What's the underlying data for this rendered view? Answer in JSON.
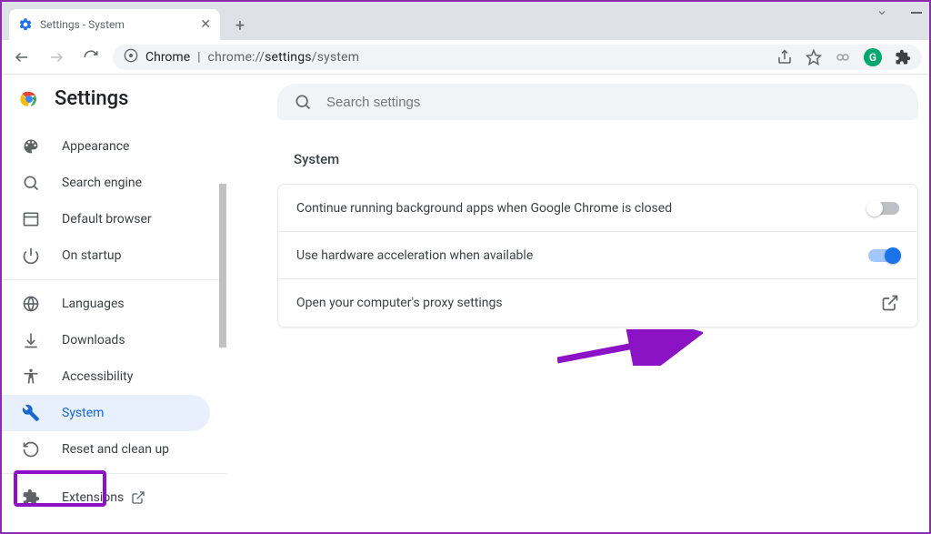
{
  "window": {
    "tab_title": "Settings - System",
    "close_glyph": "✕",
    "new_tab_glyph": "+"
  },
  "toolbar": {
    "url_prefix": "Chrome",
    "url_sep": "|",
    "url_proto": "chrome://",
    "url_path_bold": "settings",
    "url_path_tail": "/system"
  },
  "sidebar": {
    "title": "Settings",
    "items": [
      {
        "icon": "palette",
        "label": "Appearance"
      },
      {
        "icon": "search",
        "label": "Search engine"
      },
      {
        "icon": "browser",
        "label": "Default browser"
      },
      {
        "icon": "power",
        "label": "On startup"
      }
    ],
    "items2": [
      {
        "icon": "globe",
        "label": "Languages"
      },
      {
        "icon": "download",
        "label": "Downloads"
      },
      {
        "icon": "accessibility",
        "label": "Accessibility"
      },
      {
        "icon": "wrench",
        "label": "System",
        "selected": true
      },
      {
        "icon": "restore",
        "label": "Reset and clean up"
      }
    ],
    "extensions_label": "Extensions"
  },
  "main": {
    "search_placeholder": "Search settings",
    "section_title": "System",
    "rows": [
      {
        "label": "Continue running background apps when Google Chrome is closed",
        "type": "toggle",
        "value": false
      },
      {
        "label": "Use hardware acceleration when available",
        "type": "toggle",
        "value": true
      },
      {
        "label": "Open your computer's proxy settings",
        "type": "link"
      }
    ]
  }
}
